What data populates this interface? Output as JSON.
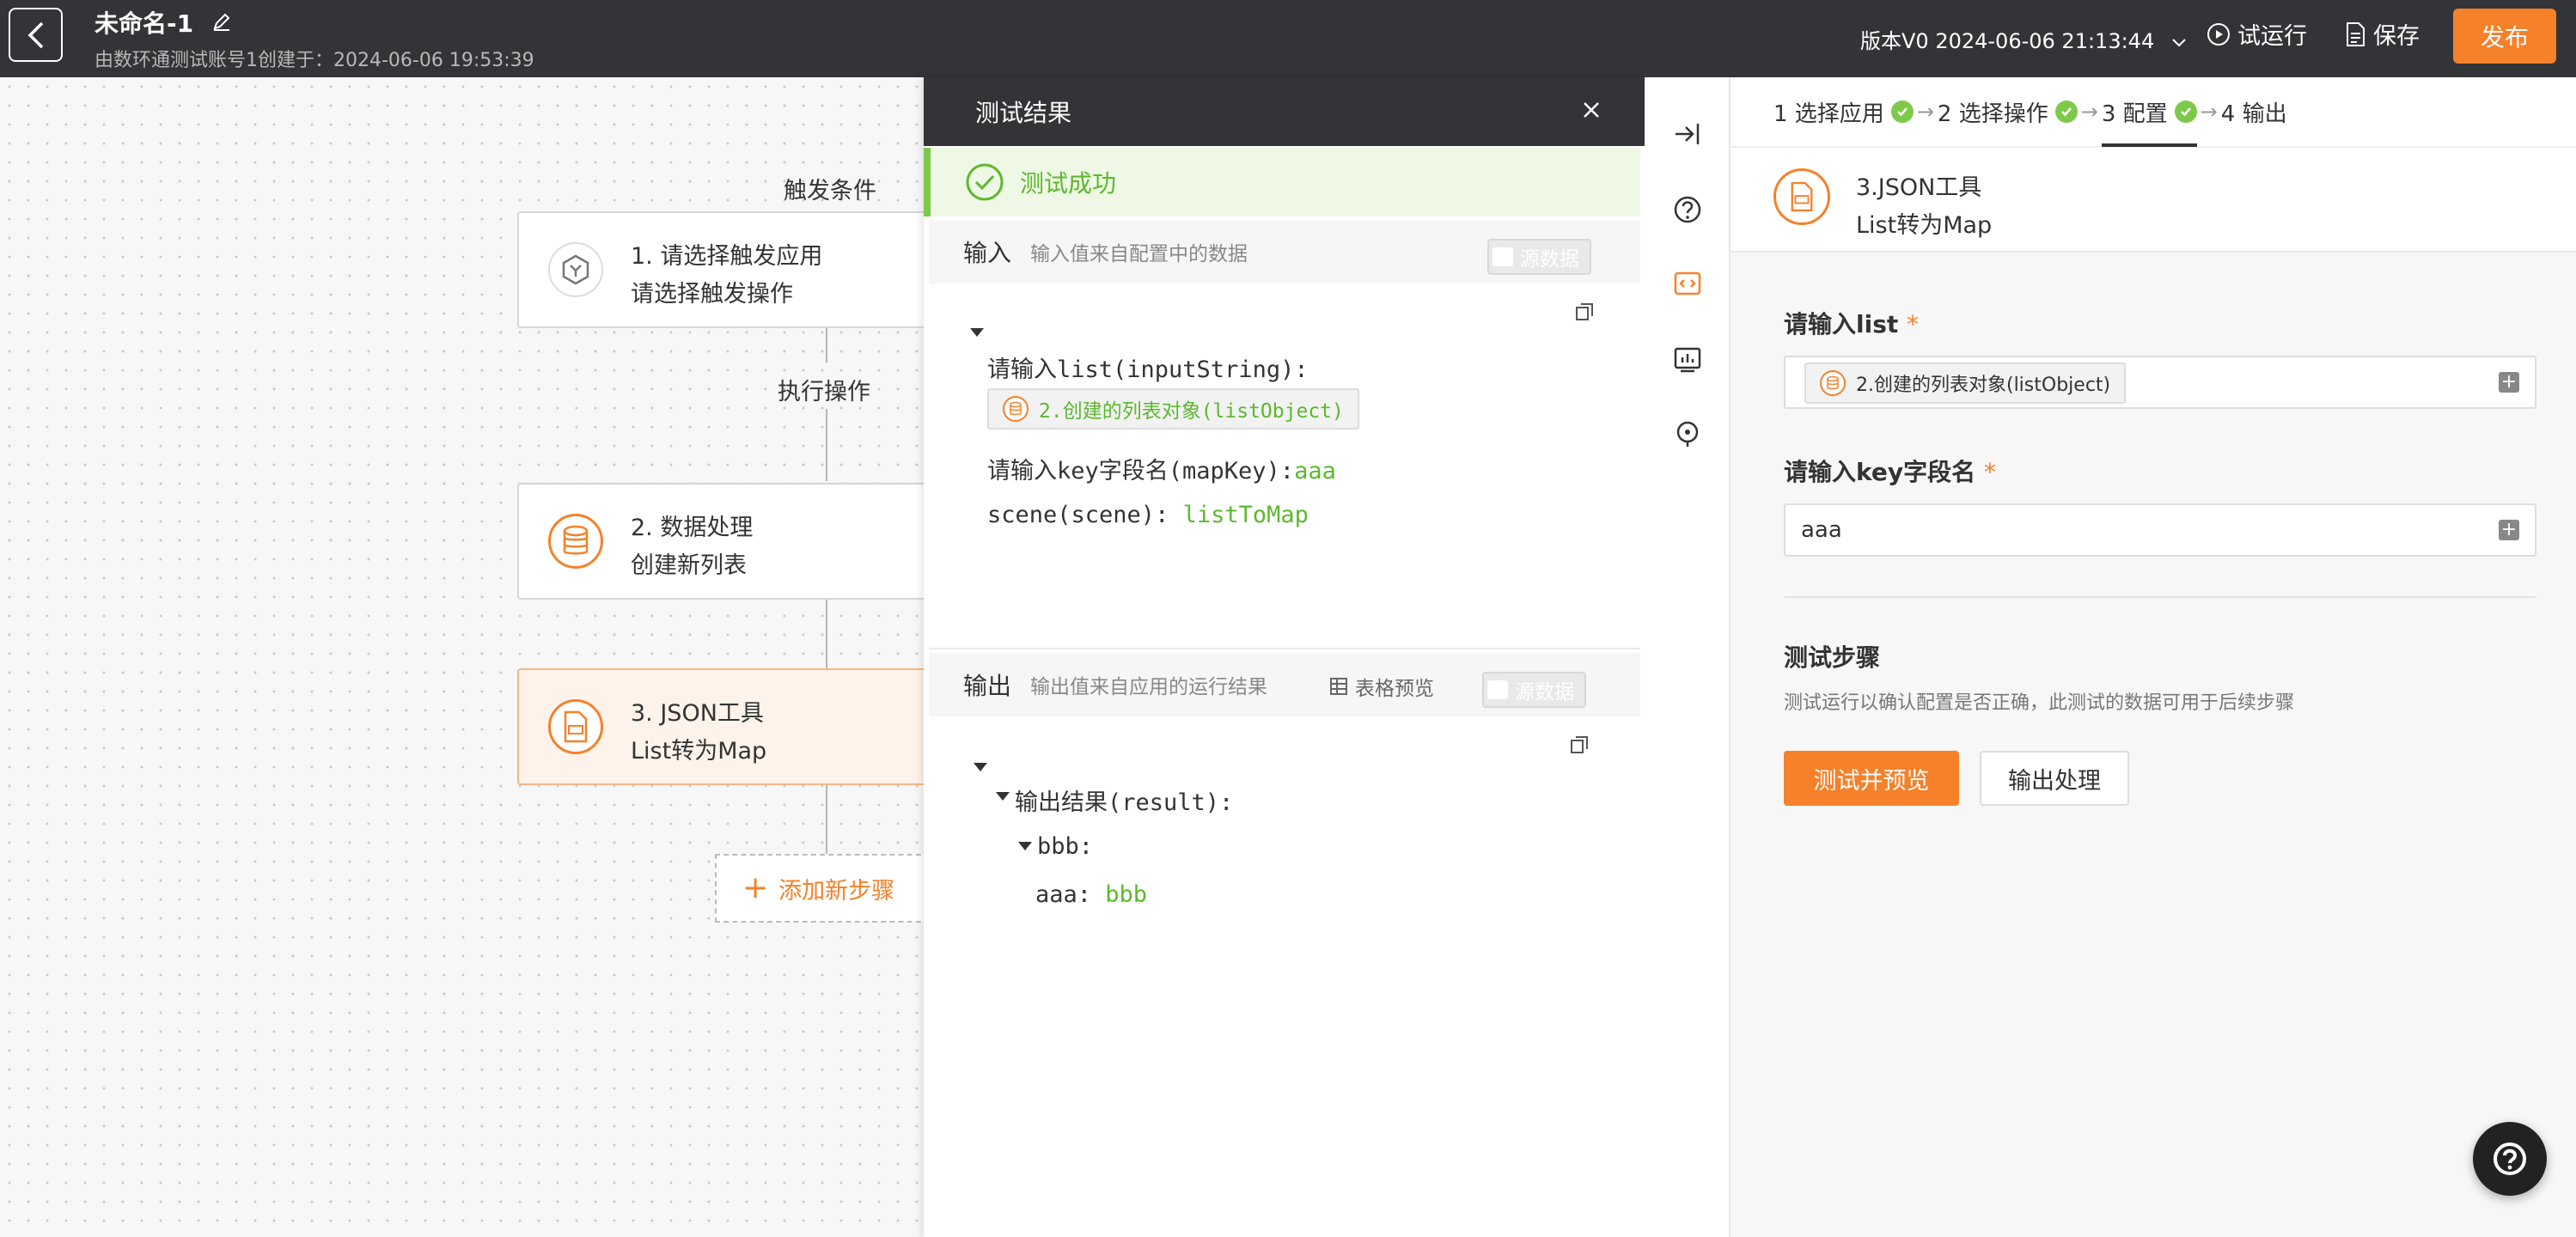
{
  "header": {
    "title": "未命名-1",
    "subtitle": "由数环通测试账号1创建于：2024-06-06 19:53:39",
    "version": "版本V0 2024-06-06 21:13:44",
    "run_label": "试运行",
    "save_label": "保存",
    "publish_label": "发布",
    "accent": "#f5812a"
  },
  "canvas": {
    "trigger_label": "触发条件",
    "action_label": "执行操作",
    "nodes": [
      {
        "line1": "1. 请选择触发应用",
        "line2": "请选择触发操作",
        "icon": "hexagon-app-icon"
      },
      {
        "line1": "2. 数据处理",
        "line2": "创建新列表",
        "icon": "database-icon"
      },
      {
        "line1": "3. JSON工具",
        "line2": "List转为Map",
        "icon": "json-file-icon"
      }
    ],
    "add_step": "添加新步骤"
  },
  "test_panel": {
    "title": "测试结果",
    "success": "测试成功",
    "input_title": "输入",
    "input_desc": "输入值来自配置中的数据",
    "source_toggle": "源数据",
    "input_fields": {
      "list_label": "请输入list(inputString):",
      "list_chip": "2.创建的列表对象(listObject)",
      "key_label": "请输入key字段名(mapKey):",
      "key_value": "aaa",
      "scene_label": "scene(scene):",
      "scene_value": "listToMap"
    },
    "output_title": "输出",
    "output_desc": "输出值来自应用的运行结果",
    "table_preview": "表格预览",
    "output_fields": {
      "result_label": "输出结果(result):",
      "bbb_label": "bbb:",
      "aaa_label": "aaa:",
      "aaa_value": "bbb"
    }
  },
  "right_panel": {
    "steps": [
      {
        "label": "1 选择应用",
        "done": true
      },
      {
        "label": "2 选择操作",
        "done": true
      },
      {
        "label": "3 配置",
        "done": true,
        "active": true
      },
      {
        "label": "4 输出",
        "done": false
      }
    ],
    "tool_title": "3.JSON工具",
    "tool_sub": "List转为Map",
    "field1_label": "请输入list",
    "field1_chip": "2.创建的列表对象(listObject)",
    "field2_label": "请输入key字段名",
    "field2_value": "aaa",
    "required_mark": "*",
    "test_title": "测试步骤",
    "test_desc": "测试运行以确认配置是否正确，此测试的数据可用于后续步骤",
    "test_btn": "测试并预览",
    "output_btn": "输出处理"
  }
}
